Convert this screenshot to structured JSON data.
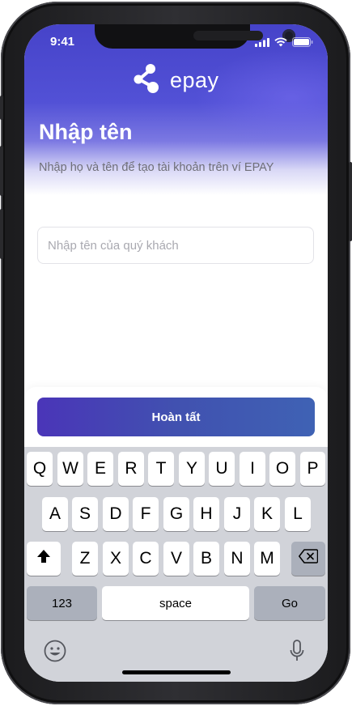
{
  "status_bar": {
    "time": "9:41"
  },
  "brand": {
    "name": "epay"
  },
  "screen": {
    "title": "Nhập tên",
    "subtitle": "Nhập họ và tên để tạo tài khoản trên ví EPAY",
    "name_input": {
      "placeholder": "Nhập tên của quý khách",
      "value": ""
    },
    "finish_button": "Hoàn tất"
  },
  "keyboard": {
    "row1": [
      "Q",
      "W",
      "E",
      "R",
      "T",
      "Y",
      "U",
      "I",
      "O",
      "P"
    ],
    "row2": [
      "A",
      "S",
      "D",
      "F",
      "G",
      "H",
      "J",
      "K",
      "L"
    ],
    "row3": [
      "Z",
      "X",
      "C",
      "V",
      "B",
      "N",
      "M"
    ],
    "numbers_key": "123",
    "space_key": "space",
    "go_key": "Go",
    "icons": [
      "shift-icon",
      "backspace-icon",
      "emoji-icon",
      "microphone-icon"
    ]
  },
  "colors": {
    "primary": "#4a35b8",
    "hero": "#4643c9",
    "keyboard": "#d1d3d9"
  }
}
